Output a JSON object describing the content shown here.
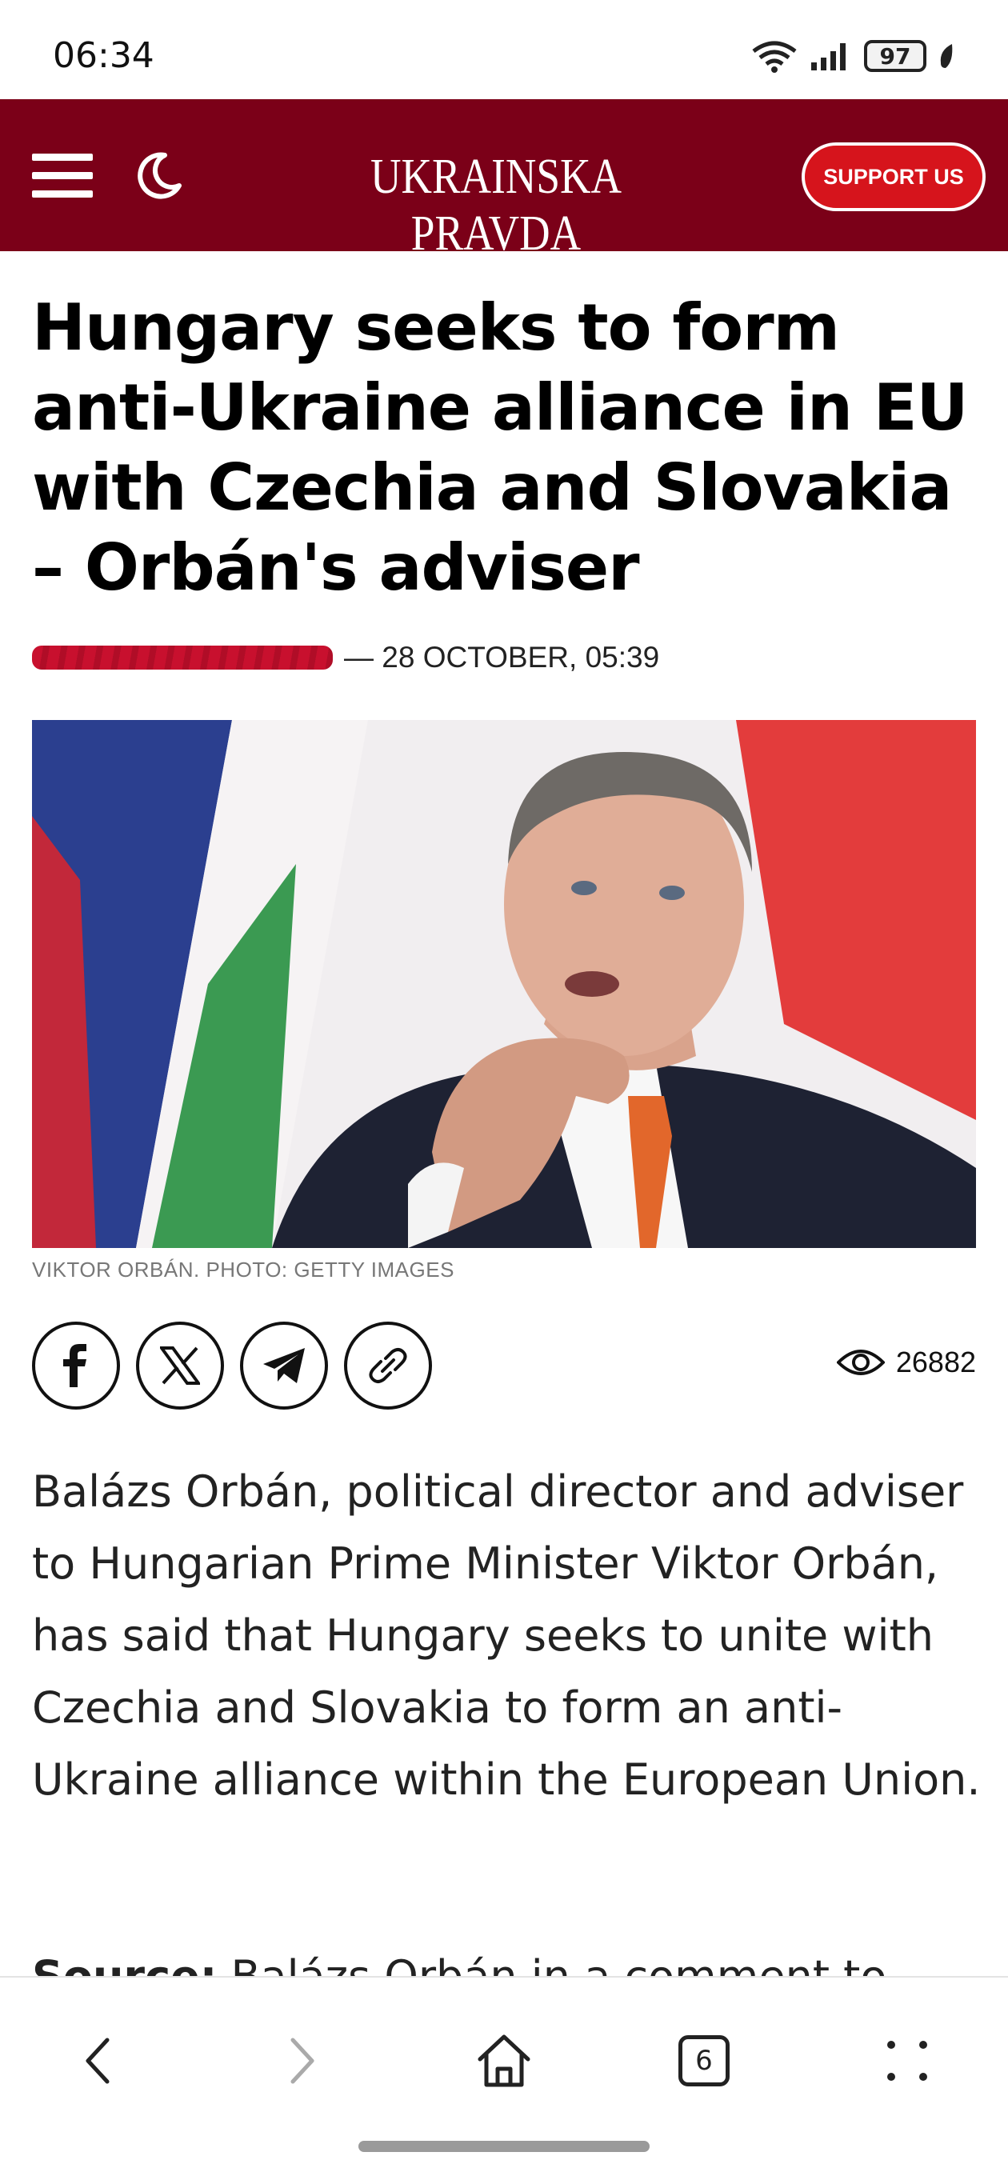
{
  "status_bar": {
    "time": "06:34",
    "battery": "97"
  },
  "header": {
    "site_title": "UKRAINSKA PRAVDA",
    "support_label": "SUPPORT US",
    "brand_color": "#7b0018",
    "accent_color": "#d6141c",
    "menu_icon": "hamburger-menu-icon",
    "theme_icon": "moon-icon"
  },
  "article": {
    "headline": "Hungary seeks to form anti-Ukraine alliance in EU with Czechia and Slovakia – Orbán's adviser",
    "byline_date": "— 28 OCTOBER, 05:39",
    "photo_caption": "VIKTOR ORBÁN. PHOTO: GETTY IMAGES",
    "views": "26882",
    "share_icons": [
      "facebook-icon",
      "x-icon",
      "telegram-icon",
      "link-icon"
    ],
    "body": "Balázs Orbán, political director and adviser to Hungarian Prime Minister Viktor Orbán, has said that Hungary seeks to unite with Czechia and Slovakia to form an anti-Ukraine alliance within the European Union.",
    "source_label": "Source:",
    "source_text": "Balázs Orbán in a comment to"
  },
  "bottom_nav": {
    "tabs_count": "6",
    "icons": [
      "back-icon",
      "forward-icon",
      "home-icon",
      "tabs-icon",
      "more-icon"
    ]
  }
}
